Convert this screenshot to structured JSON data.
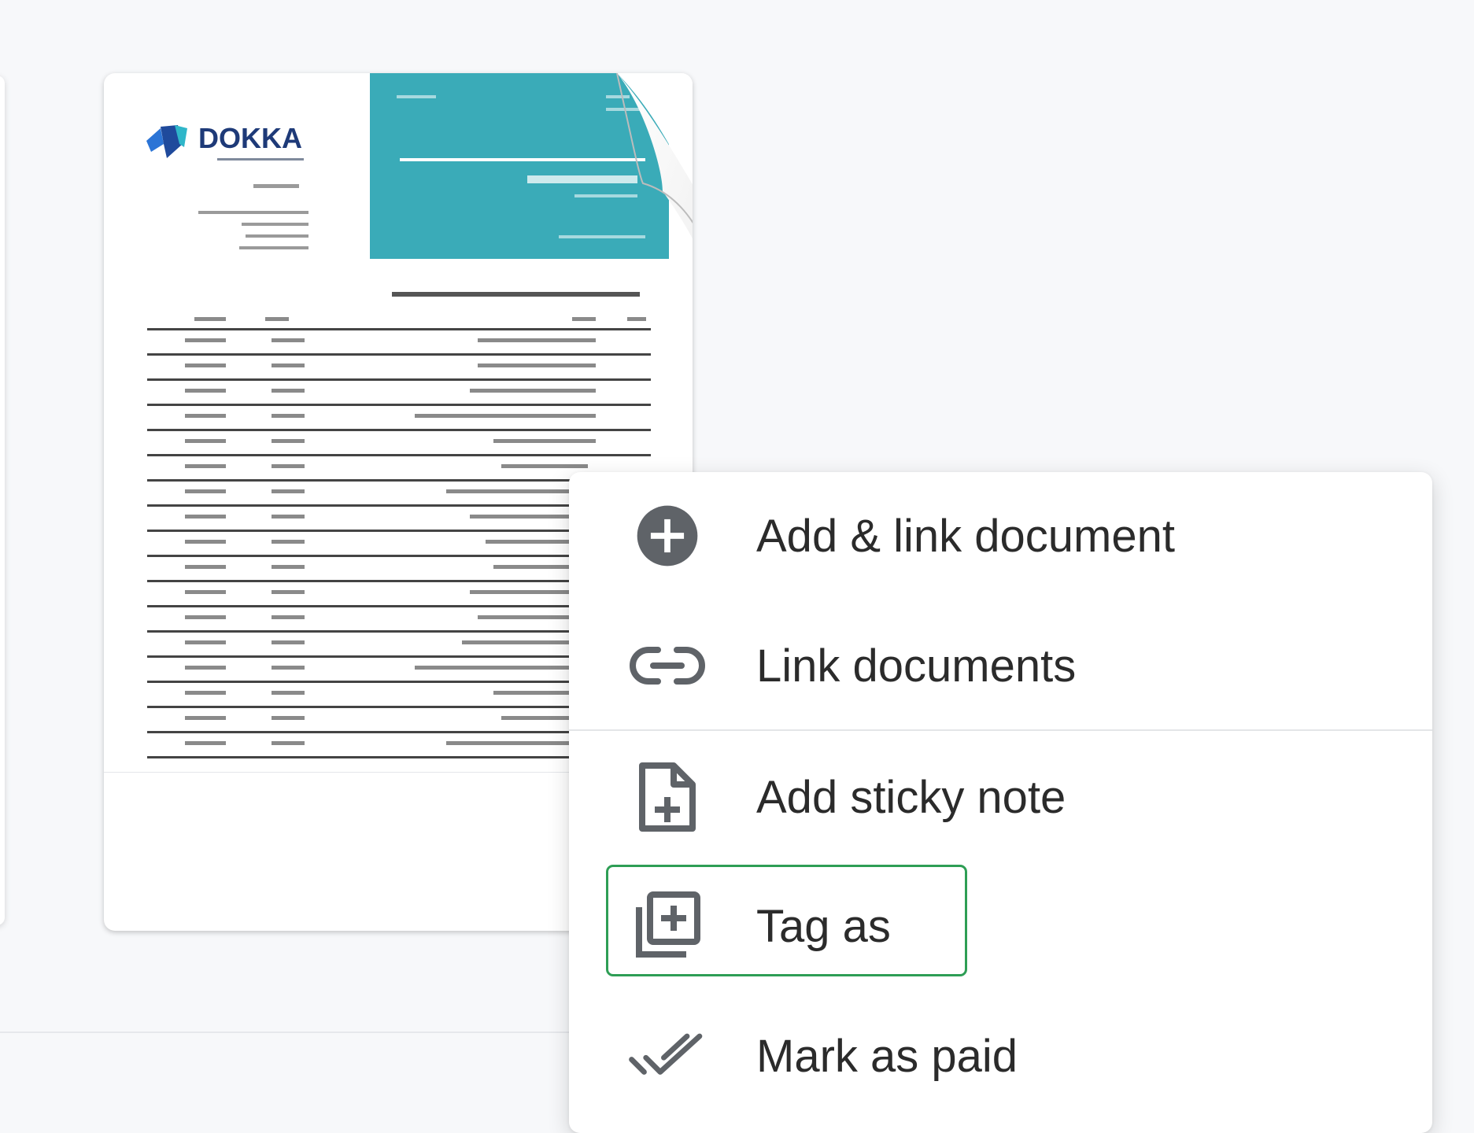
{
  "document_card": {
    "logo_text": "DOKKA"
  },
  "context_menu": {
    "items": [
      {
        "label": "Add & link document",
        "icon": "add-circle-icon"
      },
      {
        "label": "Link documents",
        "icon": "link-icon"
      },
      {
        "label": "Add sticky note",
        "icon": "note-add-icon"
      },
      {
        "label": "Tag as",
        "icon": "library-add-icon",
        "focused": true
      },
      {
        "label": "Mark as paid",
        "icon": "done-all-icon"
      }
    ]
  },
  "colors": {
    "background": "#f7f8fa",
    "menu_text": "#2b2b2b",
    "icon": "#5f6368",
    "focus_ring": "#2e9e55",
    "thumbnail_accent": "#3aabb8",
    "logo_navy": "#1e3a78"
  }
}
